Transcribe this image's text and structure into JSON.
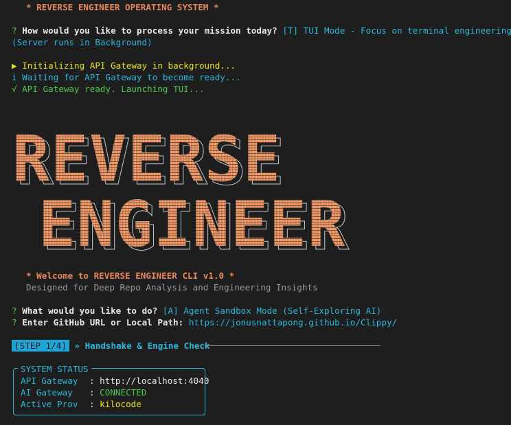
{
  "header": {
    "title": "* REVERSE ENGINEER OPERATING SYSTEM *"
  },
  "prompt1": {
    "mark": "?",
    "question": "How would you like to process your mission today?",
    "answer_line1": "[T] TUI Mode - Focus on terminal engineering",
    "answer_line2": "(Server runs in Background)"
  },
  "log": [
    {
      "icon": "▶",
      "text": "Initializing API Gateway in background..."
    },
    {
      "icon": "i",
      "text": "Waiting for API Gateway to become ready..."
    },
    {
      "icon": "√",
      "text": "API Gateway ready. Launching TUI..."
    }
  ],
  "banner": {
    "line1": "REVERSE",
    "line2": "ENGINEER"
  },
  "welcome": {
    "title": "* Welcome to REVERSE ENGINEER CLI v1.0 *",
    "subtitle": "Designed for Deep Repo Analysis and Engineering Insights"
  },
  "prompt2": {
    "mark": "?",
    "question": "What would you like to do?",
    "answer": "[A] Agent Sandbox Mode (Self-Exploring AI)"
  },
  "prompt3": {
    "mark": "?",
    "question": "Enter GitHub URL or Local Path:",
    "answer": "https://jonusnattapong.github.io/Clippy/"
  },
  "step": {
    "badge": "[STEP 1/4]",
    "title": "» Handshake & Engine Check"
  },
  "status": {
    "title": "SYSTEM STATUS",
    "rows": [
      {
        "key": "API Gateway",
        "sep": ": ",
        "value": "http://localhost:4040"
      },
      {
        "key": "AI Gateway",
        "sep": ": ",
        "value": "CONNECTED"
      },
      {
        "key": "Active Prov",
        "sep": ": ",
        "value": "kilocode"
      }
    ]
  },
  "colors": {
    "background": "#1e1e1e",
    "accent_orange": "#e8875a",
    "cyan": "#29b8db",
    "green": "#4ec94e",
    "yellow": "#e5e510",
    "banner_gradient_start": "#e07a5a",
    "banner_gradient_end": "#f0b070"
  }
}
